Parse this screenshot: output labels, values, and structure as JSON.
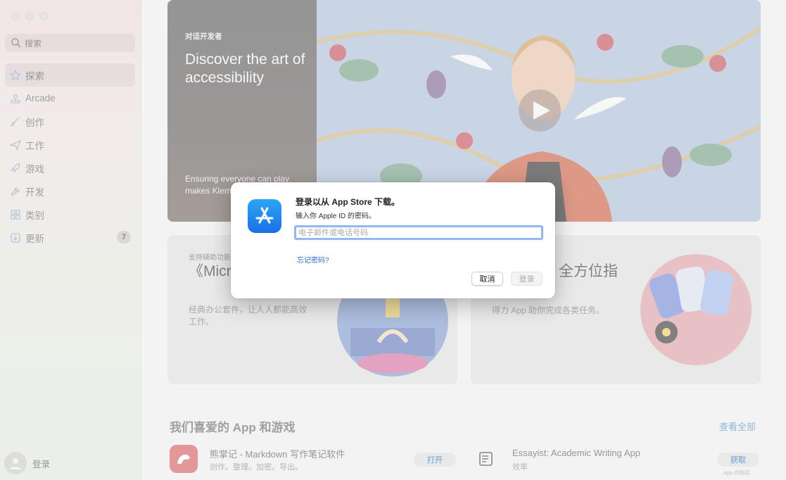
{
  "sidebar": {
    "search_placeholder": "搜索",
    "items": [
      {
        "label": "探索",
        "icon": "star-icon",
        "active": true
      },
      {
        "label": "Arcade",
        "icon": "joystick-icon"
      },
      {
        "label": "创作",
        "icon": "brush-icon"
      },
      {
        "label": "工作",
        "icon": "paperplane-icon"
      },
      {
        "label": "游戏",
        "icon": "rocket-icon"
      },
      {
        "label": "开发",
        "icon": "hammer-icon"
      },
      {
        "label": "类别",
        "icon": "grid-icon"
      },
      {
        "label": "更新",
        "icon": "download-icon",
        "badge": "7"
      }
    ],
    "account_label": "登录"
  },
  "hero": {
    "eyebrow": "对话开发者",
    "title": "Discover the art of accessibility",
    "description": "Ensuring everyone can play makes Klem games truly"
  },
  "cards": [
    {
      "eyebrow": "支持辅助功能",
      "title": "《Micro 辅助功",
      "description": "经典办公套件，让人人都能高效工作。"
    },
    {
      "title": "全方位指",
      "description": "得力 App 助你完成各类任务。"
    }
  ],
  "favorites": {
    "title": "我们喜爱的 App 和游戏",
    "see_all": "查看全部",
    "apps": [
      {
        "name": "熊掌记 - Markdown 写作笔记软件",
        "subtitle": "创作。整理。加密。导出。",
        "action": "打开"
      },
      {
        "name": "Essayist: Academic Writing App",
        "subtitle": "效率",
        "action": "获取",
        "note": "App 内购买"
      }
    ]
  },
  "dialog": {
    "title": "登录以从 App Store 下载。",
    "subtitle": "输入你 Apple ID 的密码。",
    "input_placeholder": "电子邮件或电话号码",
    "input_value": "",
    "forgot": "忘记密码?",
    "cancel": "取消",
    "login": "登录"
  },
  "colors": {
    "accent": "#2a6fd6",
    "icon_gradient": [
      "#2ba6f3",
      "#1a6fe6"
    ]
  }
}
